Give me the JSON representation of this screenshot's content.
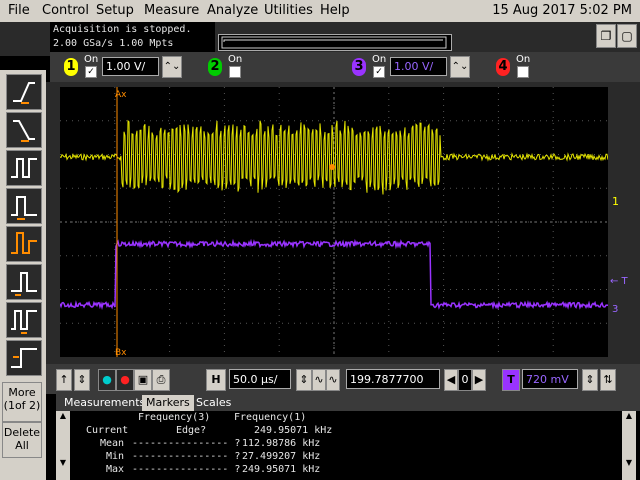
{
  "menu": {
    "items": [
      "File",
      "Control",
      "Setup",
      "Measure",
      "Analyze",
      "Utilities",
      "Help"
    ],
    "datetime": "15 Aug 2017  5:02 PM"
  },
  "status": {
    "line1": "Acquisition is stopped.",
    "line2": "2.00 GSa/s   1.00 Mpts"
  },
  "window_buttons": {
    "restore": "❐",
    "close": "▢"
  },
  "channels": [
    {
      "num": "1",
      "on_label": "On",
      "checked": true,
      "scale": "1.00 V/",
      "color": "#ffff00"
    },
    {
      "num": "2",
      "on_label": "On",
      "checked": false,
      "scale": "",
      "color": "#00cc00"
    },
    {
      "num": "3",
      "on_label": "On",
      "checked": true,
      "scale": "1.00 V/",
      "color": "#9933ff"
    },
    {
      "num": "4",
      "on_label": "On",
      "checked": false,
      "scale": "",
      "color": "#ff2222"
    }
  ],
  "left_panel": {
    "more": "More",
    "more_sub": "(1of 2)",
    "delete": "Delete",
    "delete_sub": "All"
  },
  "markers": {
    "ch1": "1",
    "T": "← T",
    "ch3": "3"
  },
  "bottom_bar": {
    "h_label": "H",
    "time_div": "50.0 µs/",
    "delay": "199.7877700 µs",
    "delay_mark": "0",
    "t_label": "T",
    "trig_level": "720 mV"
  },
  "tabs": [
    "Measurements",
    "Markers",
    "Scales"
  ],
  "measurements": {
    "header_col1": "Frequency(3)",
    "header_col2": "Frequency(1)",
    "edge": "Edge?",
    "rows": [
      {
        "label": "Current",
        "v1": "",
        "v2": "249.95071 kHz"
      },
      {
        "label": "Mean",
        "v1": "---------------- ?",
        "v2": "112.98786 kHz"
      },
      {
        "label": "Min",
        "v1": "---------------- ?",
        "v2": "27.499207 kHz"
      },
      {
        "label": "Max",
        "v1": "---------------- ?",
        "v2": "249.95071 kHz"
      }
    ]
  },
  "colors": {
    "ch1": "#ffff00",
    "ch3": "#9933ff",
    "cursor": "#ff8c00",
    "grid": "#555555"
  }
}
